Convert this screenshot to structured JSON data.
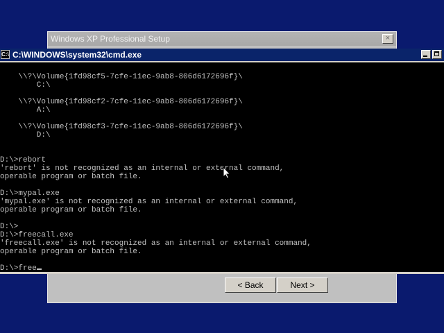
{
  "setup": {
    "title": "Windows XP Professional Setup",
    "close_glyph": "×",
    "back_label": "< Back",
    "next_label": "Next >"
  },
  "cmd": {
    "title": "C:\\WINDOWS\\system32\\cmd.exe",
    "icon_label": "C:\\",
    "lines": [
      "",
      "    \\\\?\\Volume{1fd98cf5-7cfe-11ec-9ab8-806d6172696f}\\",
      "        C:\\",
      "",
      "    \\\\?\\Volume{1fd98cf2-7cfe-11ec-9ab8-806d6172696f}\\",
      "        A:\\",
      "",
      "    \\\\?\\Volume{1fd98cf3-7cfe-11ec-9ab8-806d6172696f}\\",
      "        D:\\",
      "",
      "",
      "D:\\>rebort",
      "'rebort' is not recognized as an internal or external command,",
      "operable program or batch file.",
      "",
      "D:\\>mypal.exe",
      "'mypal.exe' is not recognized as an internal or external command,",
      "operable program or batch file.",
      "",
      "D:\\>",
      "D:\\>freecall.exe",
      "'freecall.exe' is not recognized as an internal or external command,",
      "operable program or batch file.",
      "",
      "D:\\>free"
    ]
  },
  "colors": {
    "desktop": "#0a1a6e",
    "titlebar_active": "#0a246a",
    "console_bg": "#000000",
    "console_text": "#c0c0c0"
  },
  "icons": [
    "cmd-icon",
    "minimize-icon",
    "maximize-icon",
    "close-icon",
    "mouse-pointer-icon"
  ]
}
